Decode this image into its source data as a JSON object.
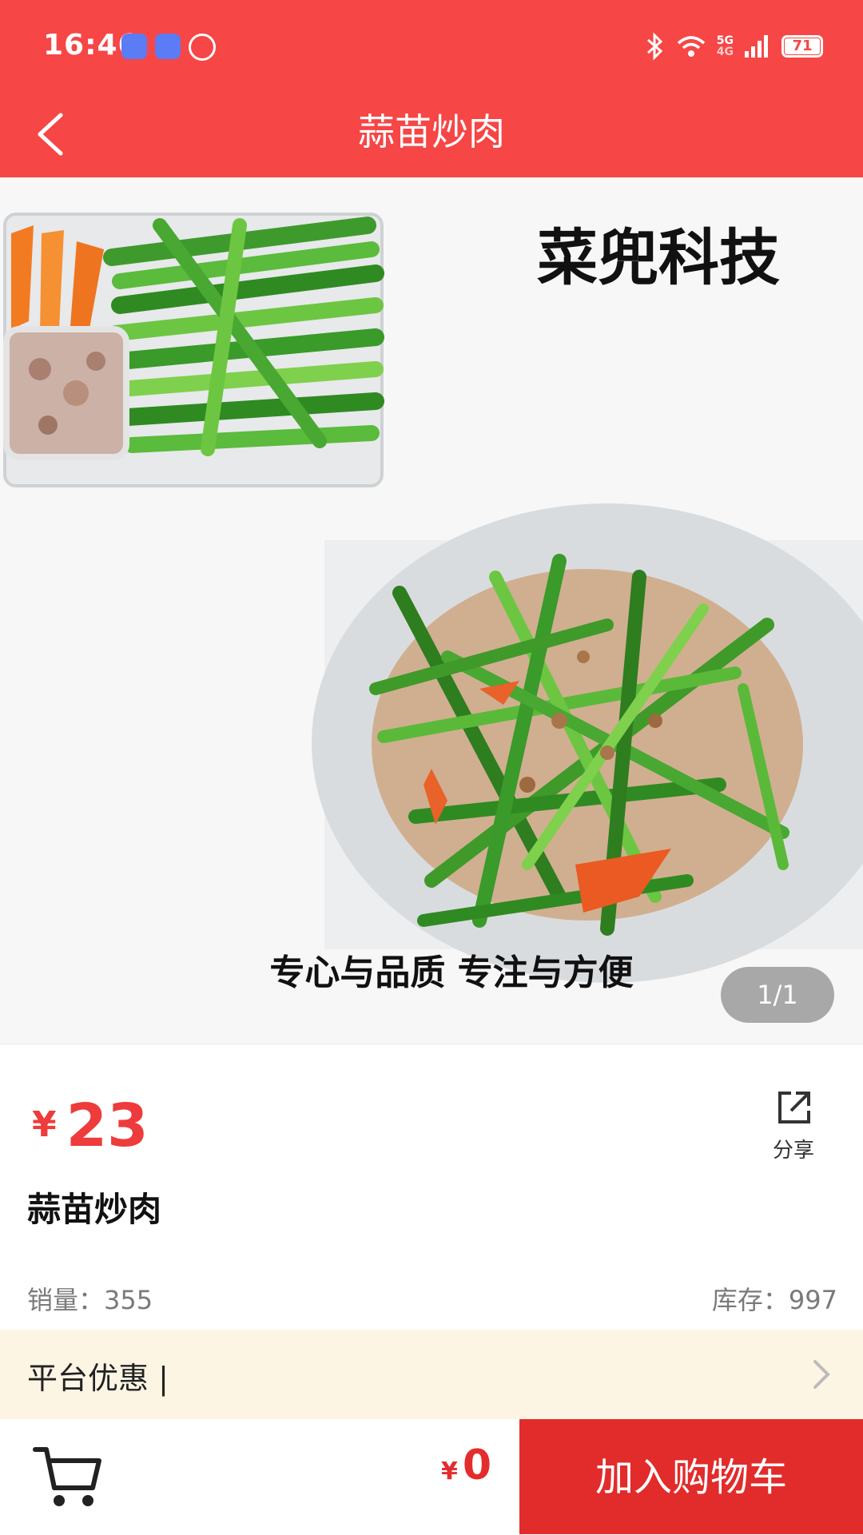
{
  "status_bar": {
    "time": "16:46",
    "battery": "71",
    "network": "5G",
    "network_sub": "4G"
  },
  "header": {
    "title": "蒜苗炒肉"
  },
  "hero": {
    "brand_text": "菜兜科技",
    "slogan": "专心与品质 专注与方便",
    "pager": "1/1"
  },
  "product": {
    "currency": "¥",
    "price": "23",
    "share_label": "分享",
    "name": "蒜苗炒肉",
    "sales_label": "销量：355",
    "stock_label": "库存：997"
  },
  "promo": {
    "label": "平台优惠 |"
  },
  "bottom_bar": {
    "currency": "¥",
    "total": "0",
    "add_to_cart_label": "加入购物车"
  },
  "colors": {
    "header_red": "#f64646",
    "price_red": "#ee3b3b",
    "button_red": "#e22b2b",
    "promo_bg": "#fdf5e4"
  }
}
